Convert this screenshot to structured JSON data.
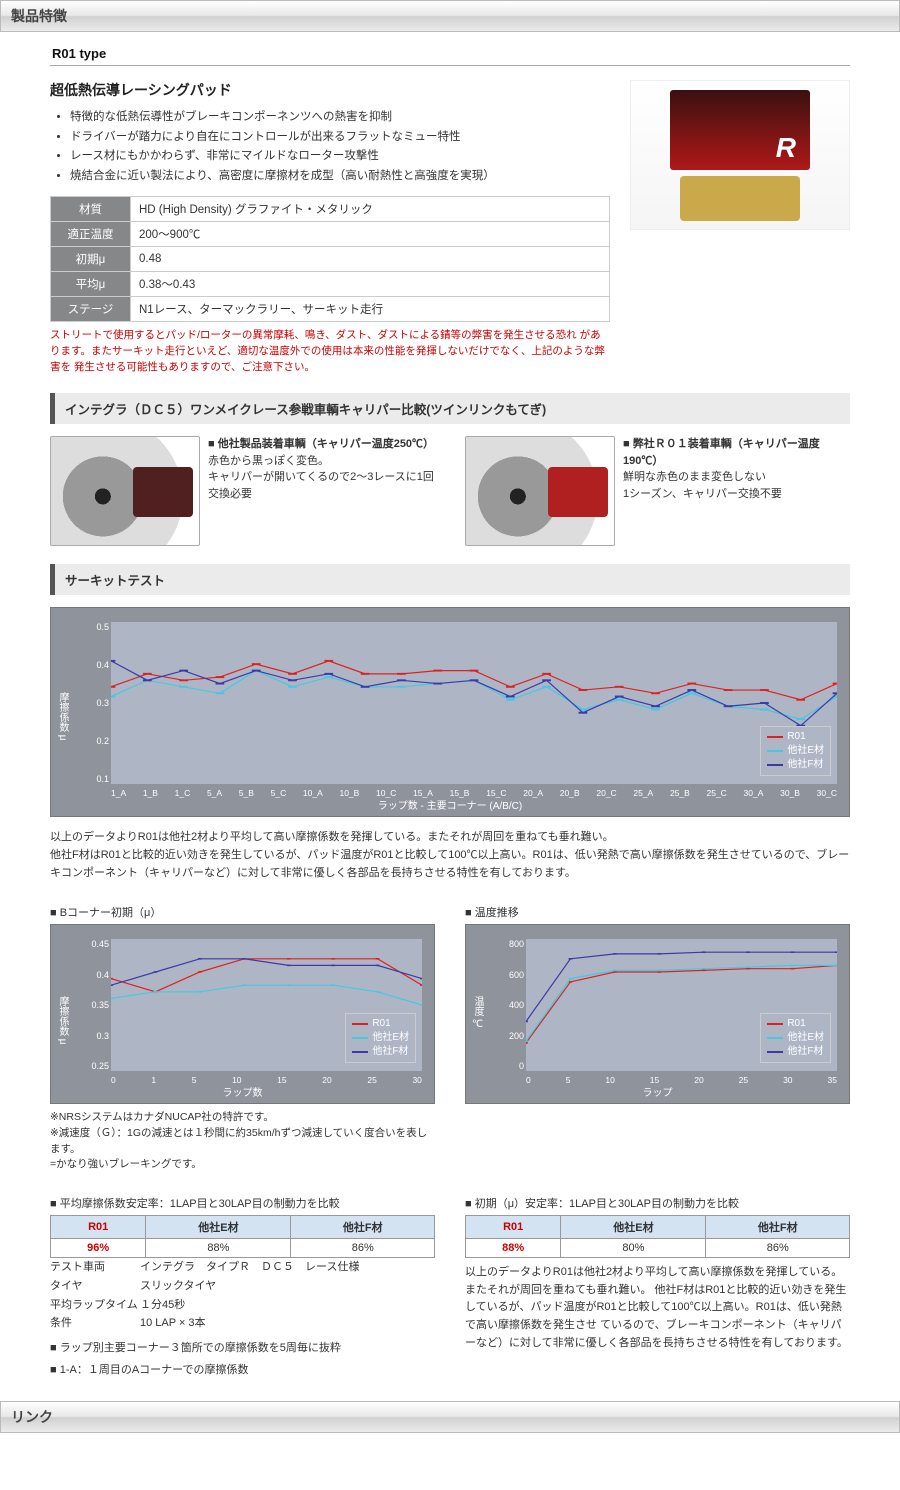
{
  "sections": {
    "features": "製品特徴",
    "link": "リンク"
  },
  "type_title": "R01 type",
  "sub_title": "超低熱伝導レーシングパッド",
  "bullets": [
    "特徴的な低熱伝導性がブレーキコンポーネンツへの熱害を抑制",
    "ドライバーが踏力により自在にコントロールが出来るフラットなミュー特性",
    "レース材にもかかわらず、非常にマイルドなローター攻撃性",
    "焼結合金に近い製法により、高密度に摩擦材を成型（高い耐熱性と高強度を実現）"
  ],
  "spec_rows": [
    {
      "h": "材質",
      "v": "HD (High Density) グラファイト・メタリック"
    },
    {
      "h": "適正温度",
      "v": "200～900℃"
    },
    {
      "h": "初期μ",
      "v": "0.48"
    },
    {
      "h": "平均μ",
      "v": "0.38～0.43"
    },
    {
      "h": "ステージ",
      "v": "N1レース、ターマックラリー、サーキット走行"
    }
  ],
  "warn": "ストリートで使用するとパッド/ローターの異常摩耗、鳴き、ダスト、ダストによる錆等の弊害を発生させる恐れ があります。またサーキット走行といえど、適切な温度外での使用は本来の性能を発揮しないだけでなく、上記のような弊害を 発生させる可能性もありますので、ご注意下さい。",
  "band1": "インテグラ（ＤＣ５）ワンメイクレース参戦車輌キャリパー比較(ツインリンクもてぎ)",
  "compare": {
    "left": {
      "title": "■ 他社製品装着車輌（キャリパー温度250℃）",
      "l1": "赤色から黒っぽく変色。",
      "l2": "キャリパーが開いてくるので2～3レースに1回交換必要"
    },
    "right": {
      "title": "■ 弊社Ｒ０１装着車輌（キャリパー温度190℃）",
      "l1": "鮮明な赤色のまま変色しない",
      "l2": "1シーズン、キャリパー交換不要"
    }
  },
  "band2": "サーキットテスト",
  "chart_data": [
    {
      "type": "line",
      "title": "",
      "xlabel": "ラップ数 - 主要コーナー (A/B/C)",
      "ylabel": "摩擦係数 μ",
      "ylim": [
        0,
        0.5
      ],
      "yticks": [
        "0.5",
        "0.4",
        "0.3",
        "0.2",
        "0.1"
      ],
      "categories": [
        "1_A",
        "1_B",
        "1_C",
        "5_A",
        "5_B",
        "5_C",
        "10_A",
        "10_B",
        "10_C",
        "15_A",
        "15_B",
        "15_C",
        "20_A",
        "20_B",
        "20_C",
        "25_A",
        "25_B",
        "25_C",
        "30_A",
        "30_B",
        "30_C"
      ],
      "series": [
        {
          "name": "R01",
          "color": "#e02020",
          "values": [
            0.3,
            0.34,
            0.32,
            0.33,
            0.37,
            0.34,
            0.38,
            0.34,
            0.34,
            0.35,
            0.35,
            0.3,
            0.34,
            0.29,
            0.3,
            0.28,
            0.31,
            0.29,
            0.29,
            0.26,
            0.31
          ]
        },
        {
          "name": "他社E材",
          "color": "#46c7e5",
          "values": [
            0.27,
            0.32,
            0.3,
            0.28,
            0.35,
            0.3,
            0.33,
            0.3,
            0.3,
            0.31,
            0.32,
            0.26,
            0.3,
            0.23,
            0.26,
            0.23,
            0.28,
            0.24,
            0.23,
            0.2,
            0.27
          ]
        },
        {
          "name": "他社F材",
          "color": "#3a3aa8",
          "values": [
            0.38,
            0.32,
            0.35,
            0.31,
            0.35,
            0.32,
            0.34,
            0.3,
            0.32,
            0.31,
            0.32,
            0.27,
            0.32,
            0.22,
            0.27,
            0.24,
            0.29,
            0.24,
            0.25,
            0.18,
            0.28
          ]
        }
      ]
    },
    {
      "type": "line",
      "title": "Bコーナー初期（μ）",
      "xlabel": "ラップ数",
      "ylabel": "摩擦係数 μ",
      "ylim": [
        0.25,
        0.45
      ],
      "yticks": [
        "0.45",
        "0.4",
        "0.35",
        "0.3",
        "0.25"
      ],
      "categories": [
        "0",
        "1",
        "5",
        "10",
        "15",
        "20",
        "25",
        "30"
      ],
      "series": [
        {
          "name": "R01",
          "color": "#e02020",
          "values": [
            0.39,
            0.37,
            0.4,
            0.42,
            0.42,
            0.42,
            0.42,
            0.38
          ]
        },
        {
          "name": "他社E材",
          "color": "#46c7e5",
          "values": [
            0.36,
            0.37,
            0.37,
            0.38,
            0.38,
            0.38,
            0.37,
            0.35
          ]
        },
        {
          "name": "他社F材",
          "color": "#3a3aa8",
          "values": [
            0.38,
            0.4,
            0.42,
            0.42,
            0.41,
            0.41,
            0.41,
            0.39
          ]
        }
      ]
    },
    {
      "type": "line",
      "title": "温度推移",
      "xlabel": "ラップ",
      "ylabel": "温度 ℃",
      "ylim": [
        0,
        800
      ],
      "yticks": [
        "800",
        "600",
        "400",
        "200",
        "0"
      ],
      "categories": [
        "0",
        "5",
        "10",
        "15",
        "20",
        "25",
        "30",
        "35"
      ],
      "series": [
        {
          "name": "R01",
          "color": "#e02020",
          "values": [
            170,
            540,
            600,
            600,
            610,
            620,
            620,
            640
          ]
        },
        {
          "name": "他社E材",
          "color": "#46c7e5",
          "values": [
            180,
            560,
            610,
            610,
            620,
            630,
            640,
            640
          ]
        },
        {
          "name": "他社F材",
          "color": "#3a3aa8",
          "values": [
            300,
            680,
            710,
            710,
            720,
            720,
            720,
            720
          ]
        }
      ]
    }
  ],
  "chart_note": "以上のデータよりR01は他社2材より平均して高い摩擦係数を発揮している。またそれが周回を重ねても垂れ難い。\n他社F材はR01と比較的近い効きを発生しているが、パッド温度がR01と比較して100℃以上高い。R01は、低い発熱で高い摩擦係数を発生させているので、ブレーキコンポーネント（キャリパーなど）に対して非常に優しく各部品を長持ちさせる特性を有しております。",
  "sub_b": "Bコーナー初期（μ）",
  "sub_temp": "温度推移",
  "nrs_note": "※NRSシステムはカナダNUCAP社の特許です。\n※減速度（Ｇ）：1Gの減速とは１秒間に約35km/hずつ減速していく度合いを表します。\n=かなり強いブレーキングです。",
  "cmp_left_title": "平均摩擦係数安定率：1LAP目と30LAP目の制動力を比較",
  "cmp_right_title": "初期（μ）安定率：1LAP目と30LAP目の制動力を比較",
  "cmp_headers": [
    "R01",
    "他社E材",
    "他社F材"
  ],
  "cmp_left_vals": [
    "96%",
    "88%",
    "86%"
  ],
  "cmp_right_vals": [
    "88%",
    "80%",
    "86%"
  ],
  "test_info": {
    "car_k": "テスト車両",
    "car_v": "インテグラ　タイプＲ　ＤＣ５　レース仕様",
    "tire_k": "タイヤ",
    "tire_v": "スリックタイヤ",
    "lap_k": "平均ラップタイム",
    "lap_v": "１分45秒",
    "cond_k": "条件",
    "cond_v": "10 LAP × 3本"
  },
  "test_notes": [
    "ラップ別主要コーナー３箇所での摩擦係数を5周毎に抜粋",
    "1-A：１周目のAコーナーでの摩擦係数"
  ],
  "right_para": "以上のデータよりR01は他社2材より平均して高い摩擦係数を発揮している。またそれが周回を重ねても垂れ難い。 他社F材はR01と比較的近い効きを発生しているが、パッド温度がR01と比較して100℃以上高い。R01は、低い発熱で高い摩擦係数を発生させ ているので、ブレーキコンポーネント（キャリパーなど）に対して非常に優しく各部品を長持ちさせる特性を有しております。"
}
